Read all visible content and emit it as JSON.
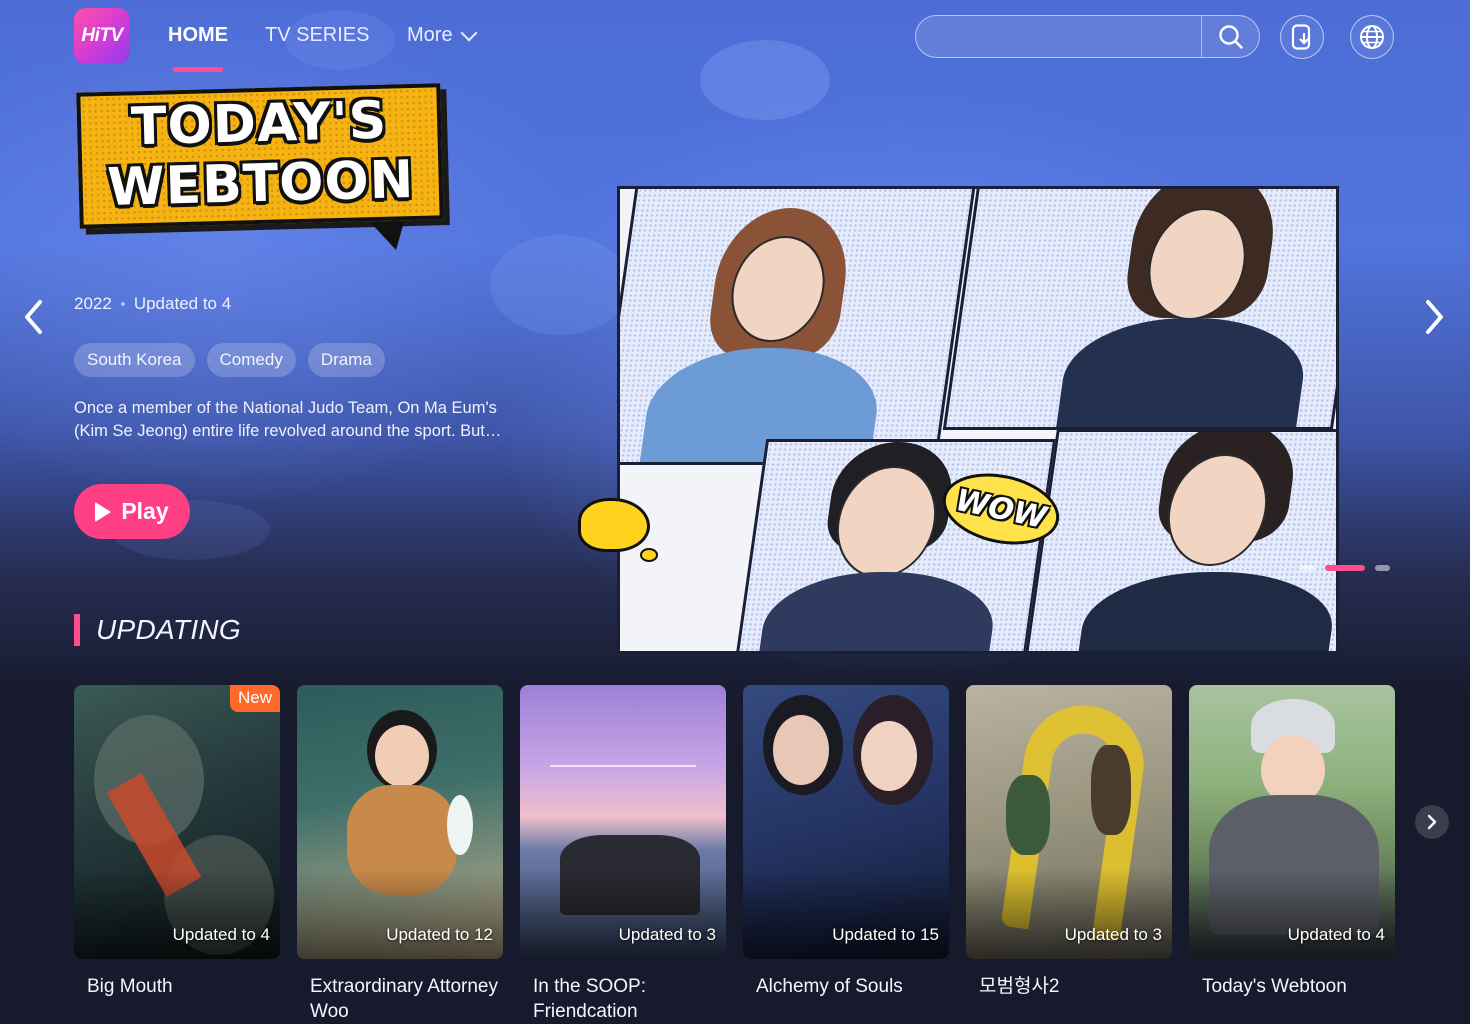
{
  "header": {
    "logo_text": "HiTV",
    "nav": {
      "home": "HOME",
      "tv_series": "TV SERIES",
      "more": "More"
    },
    "search": {
      "value": "",
      "placeholder": ""
    }
  },
  "hero": {
    "title_line1": "TODAY'S",
    "title_line2": "WEBTOON",
    "year": "2022",
    "update": "Updated to 4",
    "tags": [
      "South Korea",
      "Comedy",
      "Drama"
    ],
    "description_line1": "Once a member of the National Judo Team, On Ma Eum's",
    "description_line2": "(Kim Se Jeong) entire life revolved around the sport. But…",
    "play_label": "Play",
    "art_bubble": "WOW",
    "carousel": {
      "total": 3,
      "active": 2
    }
  },
  "updating": {
    "title": "UPDATING",
    "cards": [
      {
        "title": "Big Mouth",
        "update": "Updated to 4",
        "badge": "New"
      },
      {
        "title": "Extraordinary Attorney Woo",
        "update": "Updated to 12"
      },
      {
        "title": "In the SOOP: Friendcation",
        "update": "Updated to 3"
      },
      {
        "title": "Alchemy of Souls",
        "update": "Updated to 15"
      },
      {
        "title": "모범형사2",
        "update": "Updated to 3"
      },
      {
        "title": "Today's Webtoon",
        "update": "Updated to 4"
      }
    ]
  },
  "colors": {
    "accent": "#ff4d8d",
    "badge_new": "#ff6a2a"
  },
  "icons": {
    "search": "search-icon",
    "download": "download-icon",
    "language": "globe-icon",
    "prev": "chevron-left-icon",
    "next": "chevron-right-icon"
  }
}
